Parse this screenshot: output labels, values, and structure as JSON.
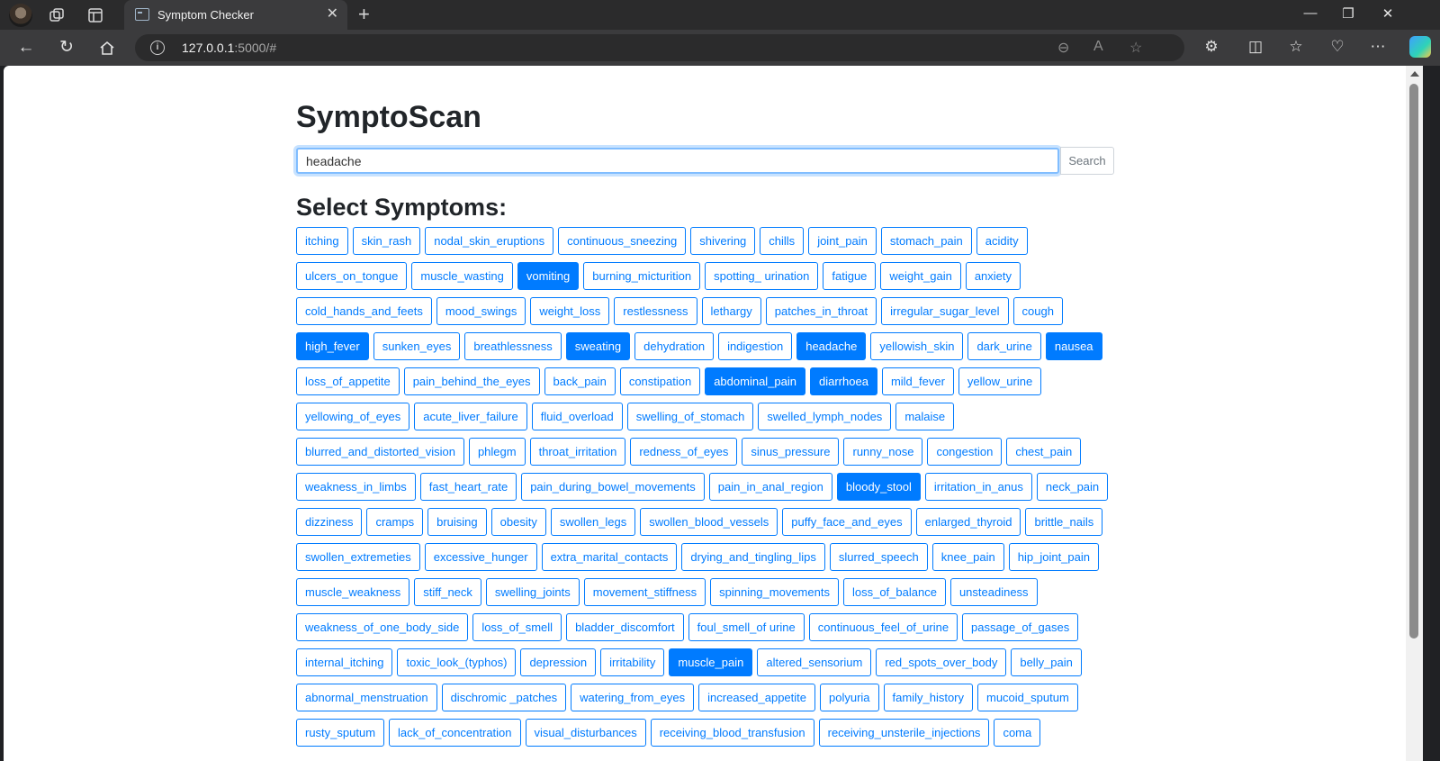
{
  "browser": {
    "tab_title": "Symptom Checker",
    "url_host": "127.0.0.1",
    "url_rest": ":5000/#"
  },
  "page": {
    "title": "SymptoScan",
    "search": {
      "value": "headache",
      "button_label": "Search"
    },
    "symptoms_heading": "Select Symptoms:",
    "accent_color": "#007bff"
  },
  "symptoms": [
    {
      "label": "itching",
      "selected": false
    },
    {
      "label": "skin_rash",
      "selected": false
    },
    {
      "label": "nodal_skin_eruptions",
      "selected": false
    },
    {
      "label": "continuous_sneezing",
      "selected": false
    },
    {
      "label": "shivering",
      "selected": false
    },
    {
      "label": "chills",
      "selected": false
    },
    {
      "label": "joint_pain",
      "selected": false
    },
    {
      "label": "stomach_pain",
      "selected": false
    },
    {
      "label": "acidity",
      "selected": false
    },
    {
      "label": "ulcers_on_tongue",
      "selected": false
    },
    {
      "label": "muscle_wasting",
      "selected": false
    },
    {
      "label": "vomiting",
      "selected": true
    },
    {
      "label": "burning_micturition",
      "selected": false
    },
    {
      "label": "spotting_ urination",
      "selected": false
    },
    {
      "label": "fatigue",
      "selected": false
    },
    {
      "label": "weight_gain",
      "selected": false
    },
    {
      "label": "anxiety",
      "selected": false
    },
    {
      "label": "cold_hands_and_feets",
      "selected": false
    },
    {
      "label": "mood_swings",
      "selected": false
    },
    {
      "label": "weight_loss",
      "selected": false
    },
    {
      "label": "restlessness",
      "selected": false
    },
    {
      "label": "lethargy",
      "selected": false
    },
    {
      "label": "patches_in_throat",
      "selected": false
    },
    {
      "label": "irregular_sugar_level",
      "selected": false
    },
    {
      "label": "cough",
      "selected": false
    },
    {
      "label": "high_fever",
      "selected": true
    },
    {
      "label": "sunken_eyes",
      "selected": false
    },
    {
      "label": "breathlessness",
      "selected": false
    },
    {
      "label": "sweating",
      "selected": true
    },
    {
      "label": "dehydration",
      "selected": false
    },
    {
      "label": "indigestion",
      "selected": false
    },
    {
      "label": "headache",
      "selected": true
    },
    {
      "label": "yellowish_skin",
      "selected": false
    },
    {
      "label": "dark_urine",
      "selected": false
    },
    {
      "label": "nausea",
      "selected": true
    },
    {
      "label": "loss_of_appetite",
      "selected": false
    },
    {
      "label": "pain_behind_the_eyes",
      "selected": false
    },
    {
      "label": "back_pain",
      "selected": false
    },
    {
      "label": "constipation",
      "selected": false
    },
    {
      "label": "abdominal_pain",
      "selected": true
    },
    {
      "label": "diarrhoea",
      "selected": true
    },
    {
      "label": "mild_fever",
      "selected": false
    },
    {
      "label": "yellow_urine",
      "selected": false
    },
    {
      "label": "yellowing_of_eyes",
      "selected": false
    },
    {
      "label": "acute_liver_failure",
      "selected": false
    },
    {
      "label": "fluid_overload",
      "selected": false
    },
    {
      "label": "swelling_of_stomach",
      "selected": false
    },
    {
      "label": "swelled_lymph_nodes",
      "selected": false
    },
    {
      "label": "malaise",
      "selected": false
    },
    {
      "label": "blurred_and_distorted_vision",
      "selected": false
    },
    {
      "label": "phlegm",
      "selected": false
    },
    {
      "label": "throat_irritation",
      "selected": false
    },
    {
      "label": "redness_of_eyes",
      "selected": false
    },
    {
      "label": "sinus_pressure",
      "selected": false
    },
    {
      "label": "runny_nose",
      "selected": false
    },
    {
      "label": "congestion",
      "selected": false
    },
    {
      "label": "chest_pain",
      "selected": false
    },
    {
      "label": "weakness_in_limbs",
      "selected": false
    },
    {
      "label": "fast_heart_rate",
      "selected": false
    },
    {
      "label": "pain_during_bowel_movements",
      "selected": false
    },
    {
      "label": "pain_in_anal_region",
      "selected": false
    },
    {
      "label": "bloody_stool",
      "selected": true
    },
    {
      "label": "irritation_in_anus",
      "selected": false
    },
    {
      "label": "neck_pain",
      "selected": false
    },
    {
      "label": "dizziness",
      "selected": false
    },
    {
      "label": "cramps",
      "selected": false
    },
    {
      "label": "bruising",
      "selected": false
    },
    {
      "label": "obesity",
      "selected": false
    },
    {
      "label": "swollen_legs",
      "selected": false
    },
    {
      "label": "swollen_blood_vessels",
      "selected": false
    },
    {
      "label": "puffy_face_and_eyes",
      "selected": false
    },
    {
      "label": "enlarged_thyroid",
      "selected": false
    },
    {
      "label": "brittle_nails",
      "selected": false
    },
    {
      "label": "swollen_extremeties",
      "selected": false
    },
    {
      "label": "excessive_hunger",
      "selected": false
    },
    {
      "label": "extra_marital_contacts",
      "selected": false
    },
    {
      "label": "drying_and_tingling_lips",
      "selected": false
    },
    {
      "label": "slurred_speech",
      "selected": false
    },
    {
      "label": "knee_pain",
      "selected": false
    },
    {
      "label": "hip_joint_pain",
      "selected": false
    },
    {
      "label": "muscle_weakness",
      "selected": false
    },
    {
      "label": "stiff_neck",
      "selected": false
    },
    {
      "label": "swelling_joints",
      "selected": false
    },
    {
      "label": "movement_stiffness",
      "selected": false
    },
    {
      "label": "spinning_movements",
      "selected": false
    },
    {
      "label": "loss_of_balance",
      "selected": false
    },
    {
      "label": "unsteadiness",
      "selected": false
    },
    {
      "label": "weakness_of_one_body_side",
      "selected": false
    },
    {
      "label": "loss_of_smell",
      "selected": false
    },
    {
      "label": "bladder_discomfort",
      "selected": false
    },
    {
      "label": "foul_smell_of urine",
      "selected": false
    },
    {
      "label": "continuous_feel_of_urine",
      "selected": false
    },
    {
      "label": "passage_of_gases",
      "selected": false
    },
    {
      "label": "internal_itching",
      "selected": false
    },
    {
      "label": "toxic_look_(typhos)",
      "selected": false
    },
    {
      "label": "depression",
      "selected": false
    },
    {
      "label": "irritability",
      "selected": false
    },
    {
      "label": "muscle_pain",
      "selected": true
    },
    {
      "label": "altered_sensorium",
      "selected": false
    },
    {
      "label": "red_spots_over_body",
      "selected": false
    },
    {
      "label": "belly_pain",
      "selected": false
    },
    {
      "label": "abnormal_menstruation",
      "selected": false
    },
    {
      "label": "dischromic _patches",
      "selected": false
    },
    {
      "label": "watering_from_eyes",
      "selected": false
    },
    {
      "label": "increased_appetite",
      "selected": false
    },
    {
      "label": "polyuria",
      "selected": false
    },
    {
      "label": "family_history",
      "selected": false
    },
    {
      "label": "mucoid_sputum",
      "selected": false
    },
    {
      "label": "rusty_sputum",
      "selected": false
    },
    {
      "label": "lack_of_concentration",
      "selected": false
    },
    {
      "label": "visual_disturbances",
      "selected": false
    },
    {
      "label": "receiving_blood_transfusion",
      "selected": false
    },
    {
      "label": "receiving_unsterile_injections",
      "selected": false
    },
    {
      "label": "coma",
      "selected": false
    }
  ]
}
